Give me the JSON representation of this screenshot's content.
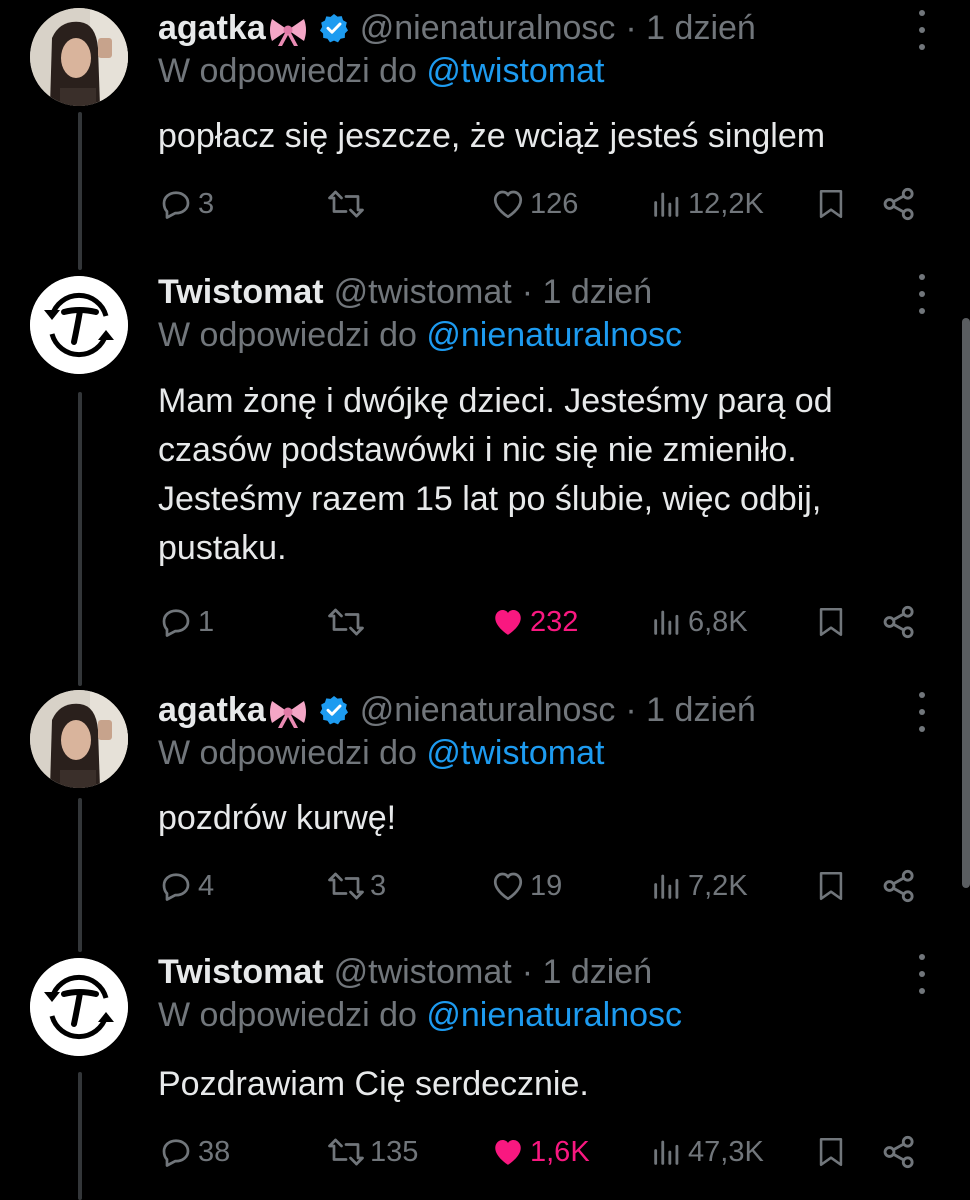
{
  "colors": {
    "background": "#000000",
    "text": "#e7e9ea",
    "muted": "#71767b",
    "link": "#1d9bf0",
    "like": "#f91880"
  },
  "tweets": [
    {
      "name": "agatka",
      "handle": "@nienaturalnosc",
      "time": "· 1 dzień",
      "verified": true,
      "reply_prefix": "W odpowiedzi do",
      "reply_to": "@twistomat",
      "text": "popłacz się jeszcze, że wciąż jesteś singlem",
      "replies": "3",
      "retweets": "",
      "likes": "126",
      "liked": false,
      "views": "12,2K"
    },
    {
      "name": "Twistomat",
      "handle": "@twistomat",
      "time": "· 1 dzień",
      "verified": false,
      "reply_prefix": "W odpowiedzi do",
      "reply_to": "@nienaturalnosc",
      "text_lines": [
        "Mam żonę i dwójkę dzieci. Jesteśmy parą od",
        "czasów podstawówki i nic się nie zmieniło.",
        "Jesteśmy razem 15 lat po ślubie, więc odbij,",
        "pustaku."
      ],
      "replies": "1",
      "retweets": "",
      "likes": "232",
      "liked": true,
      "views": "6,8K"
    },
    {
      "name": "agatka",
      "handle": "@nienaturalnosc",
      "time": "· 1 dzień",
      "verified": true,
      "reply_prefix": "W odpowiedzi do",
      "reply_to": "@twistomat",
      "text": "pozdrów kurwę!",
      "replies": "4",
      "retweets": "3",
      "likes": "19",
      "liked": false,
      "views": "7,2K"
    },
    {
      "name": "Twistomat",
      "handle": "@twistomat",
      "time": "· 1 dzień",
      "verified": false,
      "reply_prefix": "W odpowiedzi do",
      "reply_to": "@nienaturalnosc",
      "text": "Pozdrawiam Cię serdecznie.",
      "replies": "38",
      "retweets": "135",
      "likes": "1,6K",
      "liked": true,
      "views": "47,3K"
    }
  ]
}
